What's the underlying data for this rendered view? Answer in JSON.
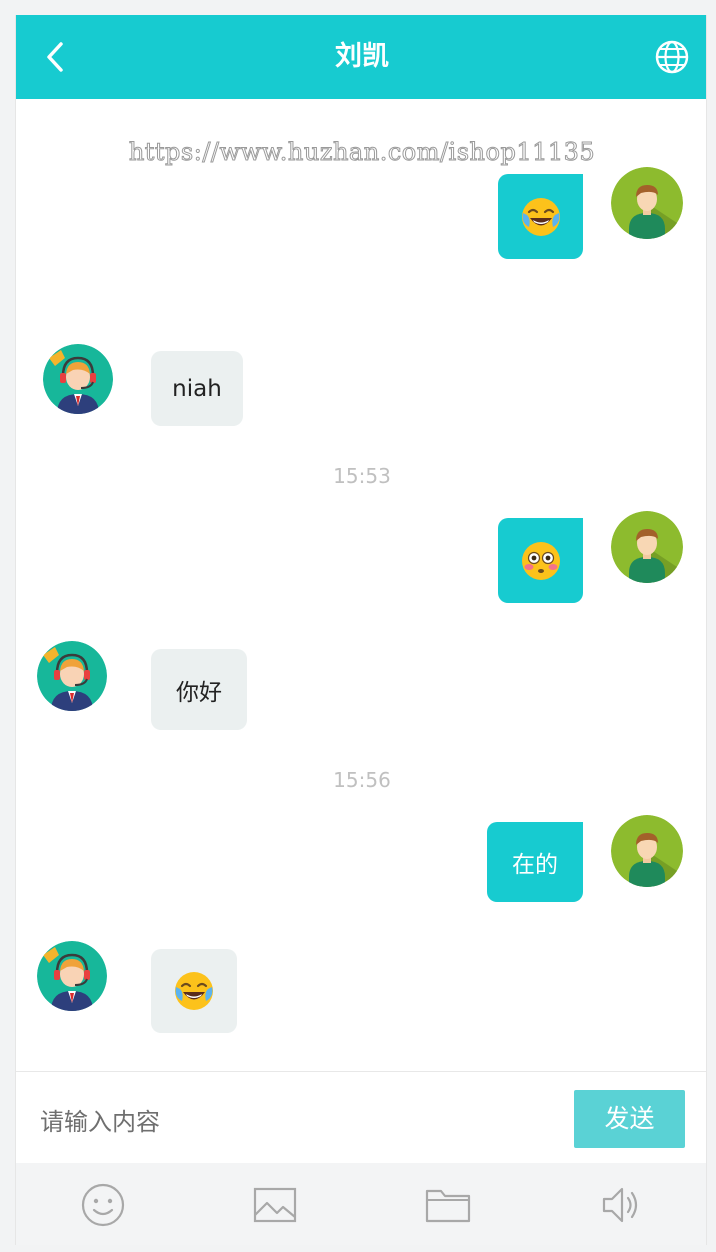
{
  "header": {
    "title": "刘凯"
  },
  "watermark": "https://www.huzhan.com/ishop11135",
  "messages": {
    "m1": {
      "from": "self",
      "content": "emoji",
      "emoji": "face-with-tears-of-joy"
    },
    "m2": {
      "from": "agent",
      "text": "niah"
    },
    "t1": "15:53",
    "m3": {
      "from": "self",
      "content": "emoji",
      "emoji": "flushed-face"
    },
    "m4": {
      "from": "agent",
      "text": "你好"
    },
    "t2": "15:56",
    "m5": {
      "from": "self",
      "text": "在的"
    },
    "m6": {
      "from": "agent",
      "content": "emoji",
      "emoji": "face-with-tears-of-joy"
    }
  },
  "composer": {
    "placeholder": "请输入内容",
    "send_label": "发送"
  },
  "toolbar": [
    "emoji-icon",
    "image-icon",
    "folder-icon",
    "speaker-icon"
  ],
  "colors": {
    "accent": "#17cbd0",
    "send": "#5ad2d5",
    "incoming_bubble": "#ebf0f0"
  }
}
